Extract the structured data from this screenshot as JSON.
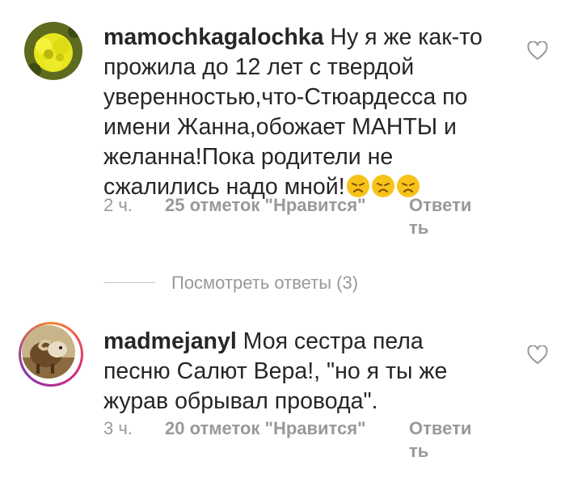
{
  "comments": [
    {
      "username": "mamochkagalochka",
      "text": "Ну я же как-то прожила до 12 лет с твердой уверенностью,что-Стюардесса по имени Жанна,обожает МАНТЫ и желанна!Пока родители не сжалились надо мной!",
      "emoji_icons": [
        "tired-face-emoji",
        "tired-face-emoji",
        "tired-face-emoji"
      ],
      "time": "2 ч.",
      "likes": "25 отметок \"Нравится\"",
      "reply": "Ответить",
      "avatar_icon": "yellow-flowers-avatar"
    },
    {
      "username": "madmejanyl",
      "text": "Моя сестра пела песню Салют Вера!, \"но я ты же журав обрывал провода\".",
      "time": "3 ч.",
      "likes": "20 отметок \"Нравится\"",
      "reply": "Ответить",
      "avatar_icon": "ram-avatar"
    }
  ],
  "view_replies": "Посмотреть ответы (3)",
  "colors": {
    "text": "#262626",
    "muted": "#999999",
    "emoji": "#f7c21a",
    "story_ring": [
      "#f58529",
      "#dd2a7b",
      "#8134af"
    ]
  }
}
